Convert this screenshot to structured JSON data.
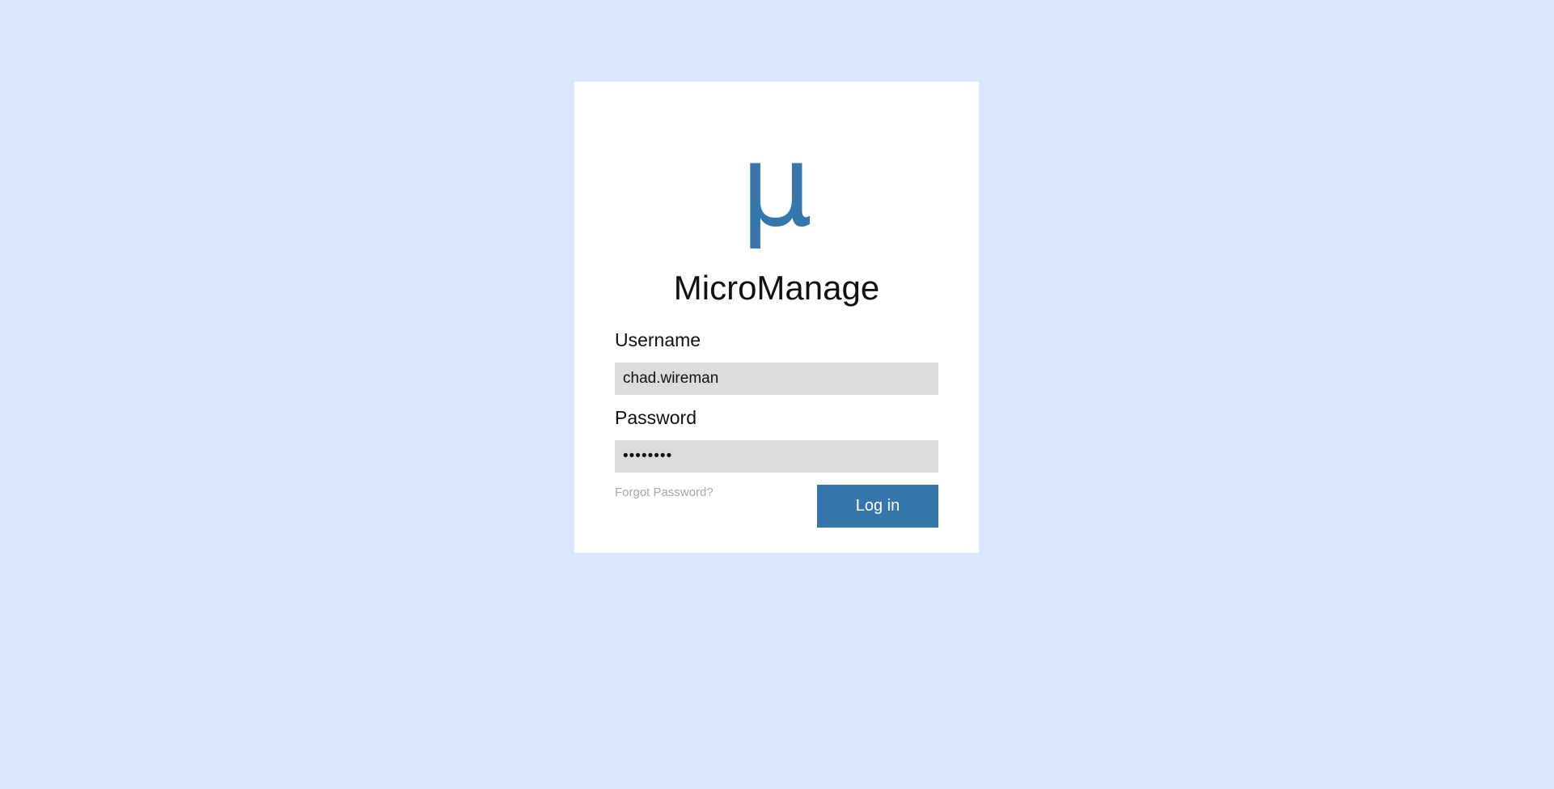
{
  "app": {
    "logo_glyph": "μ",
    "title": "MicroManage"
  },
  "form": {
    "username_label": "Username",
    "username_value": "chad.wireman",
    "password_label": "Password",
    "password_value": "••••••••",
    "forgot_link": "Forgot Password?",
    "login_button": "Log in"
  },
  "colors": {
    "background": "#d8e7f9",
    "card": "#ffffff",
    "accent": "#3577ad",
    "input_bg": "#dcdcdc",
    "muted_link": "#a6a6a6"
  }
}
